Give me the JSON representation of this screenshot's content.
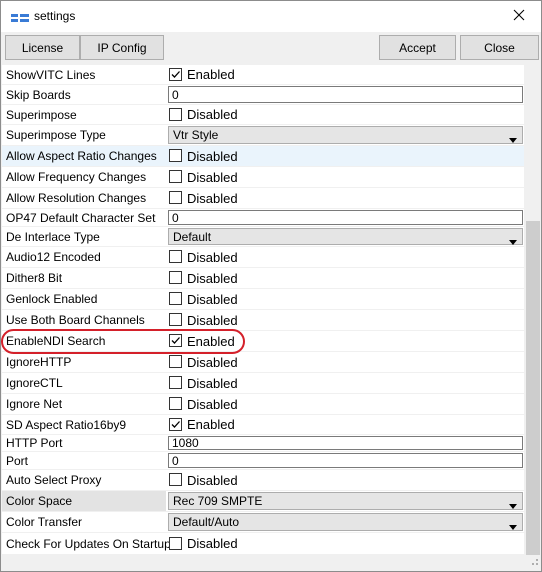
{
  "window": {
    "title": "settings",
    "app_icon": "app-logo-icon",
    "close_icon": "close-icon"
  },
  "toolbar": {
    "license_label": "License",
    "ipconfig_label": "IP Config",
    "accept_label": "Accept",
    "close_label": "Close"
  },
  "rows": [
    {
      "label": "ShowVITC Lines",
      "type": "checkbox",
      "checked": true,
      "value": "Enabled"
    },
    {
      "label": "Skip Boards",
      "type": "text",
      "value": "0"
    },
    {
      "label": "Superimpose",
      "type": "checkbox",
      "checked": false,
      "value": "Disabled"
    },
    {
      "label": "Superimpose Type",
      "type": "dropdown",
      "value": "Vtr Style"
    },
    {
      "label": "Allow Aspect Ratio Changes",
      "type": "checkbox",
      "checked": false,
      "value": "Disabled"
    },
    {
      "label": "Allow Frequency Changes",
      "type": "checkbox",
      "checked": false,
      "value": "Disabled"
    },
    {
      "label": "Allow Resolution Changes",
      "type": "checkbox",
      "checked": false,
      "value": "Disabled"
    },
    {
      "label": "OP47 Default Character Set",
      "type": "text",
      "value": "0"
    },
    {
      "label": "De Interlace Type",
      "type": "dropdown",
      "value": "Default"
    },
    {
      "label": "Audio12 Encoded",
      "type": "checkbox",
      "checked": false,
      "value": "Disabled"
    },
    {
      "label": "Dither8 Bit",
      "type": "checkbox",
      "checked": false,
      "value": "Disabled"
    },
    {
      "label": "Genlock Enabled",
      "type": "checkbox",
      "checked": false,
      "value": "Disabled"
    },
    {
      "label": "Use Both Board Channels",
      "type": "checkbox",
      "checked": false,
      "value": "Disabled"
    },
    {
      "label": "EnableNDI Search",
      "type": "checkbox",
      "checked": true,
      "value": "Enabled"
    },
    {
      "label": "IgnoreHTTP",
      "type": "checkbox",
      "checked": false,
      "value": "Disabled"
    },
    {
      "label": "IgnoreCTL",
      "type": "checkbox",
      "checked": false,
      "value": "Disabled"
    },
    {
      "label": "Ignore Net",
      "type": "checkbox",
      "checked": false,
      "value": "Disabled"
    },
    {
      "label": "SD Aspect Ratio16by9",
      "type": "checkbox",
      "checked": true,
      "value": "Enabled"
    },
    {
      "label": "HTTP Port",
      "type": "text",
      "value": "1080"
    },
    {
      "label": "Port",
      "type": "text",
      "value": "0"
    },
    {
      "label": "Auto Select Proxy",
      "type": "checkbox",
      "checked": false,
      "value": "Disabled"
    },
    {
      "label": "Color Space",
      "type": "dropdown",
      "value": "Rec 709 SMPTE"
    },
    {
      "label": "Color Transfer",
      "type": "dropdown",
      "value": "Default/Auto"
    },
    {
      "label": "Check For Updates On Startup",
      "type": "checkbox",
      "checked": false,
      "value": "Disabled"
    }
  ],
  "highlight": {
    "row_label": "EnableNDI Search",
    "color": "#d4202a"
  },
  "colors": {
    "selected_row": "#eaf4fc",
    "header_highlight": "#e3e3e3"
  }
}
